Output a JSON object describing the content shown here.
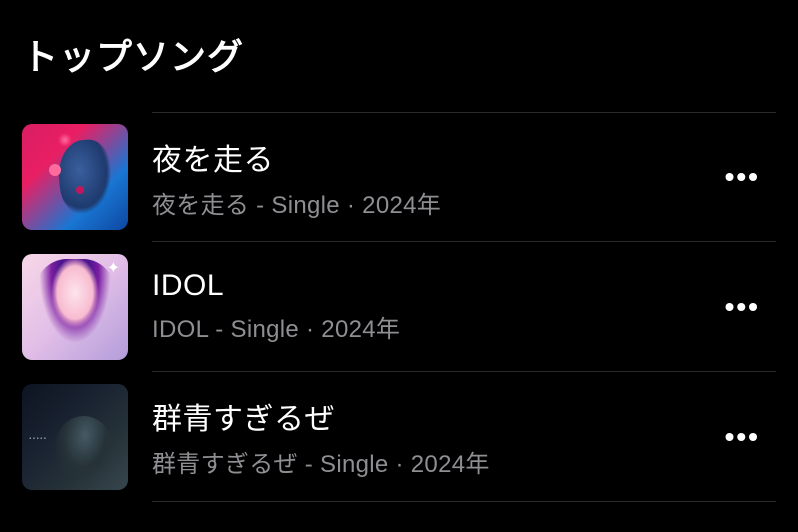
{
  "section": {
    "title": "トップソング"
  },
  "songs": [
    {
      "title": "夜を走る",
      "subtitle": "夜を走る - Single · 2024年"
    },
    {
      "title": "IDOL",
      "subtitle": "IDOL - Single · 2024年"
    },
    {
      "title": "群青すぎるぜ",
      "subtitle": "群青すぎるぜ - Single · 2024年"
    }
  ],
  "more_label": "•••"
}
